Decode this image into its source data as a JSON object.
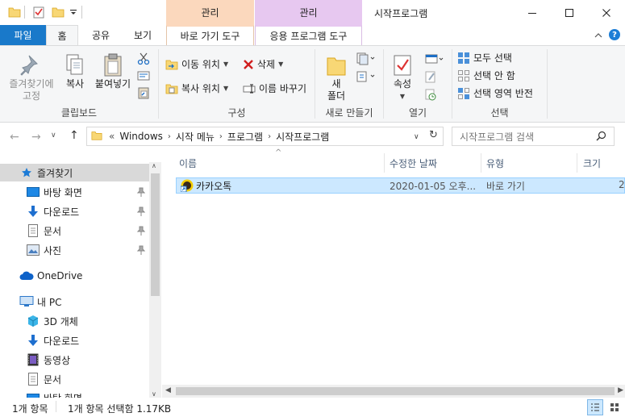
{
  "window": {
    "title": "시작프로그램",
    "context_tab_1": "관리",
    "context_tab_2": "관리",
    "context_sub_1": "바로 가기 도구",
    "context_sub_2": "응용 프로그램 도구"
  },
  "tabs": {
    "file": "파일",
    "home": "홈",
    "share": "공유",
    "view": "보기"
  },
  "ribbon": {
    "clipboard": {
      "label": "클립보드",
      "pin": "즐겨찾기에\n고정",
      "pin_line1": "즐겨찾기에",
      "pin_line2": "고정",
      "copy": "복사",
      "paste": "붙여넣기"
    },
    "organize": {
      "label": "구성",
      "move_to": "이동 위치",
      "copy_to": "복사 위치",
      "delete": "삭제",
      "rename": "이름 바꾸기"
    },
    "new": {
      "label": "새로 만들기",
      "new_folder_line1": "새",
      "new_folder_line2": "폴더"
    },
    "open": {
      "label": "열기",
      "properties": "속성"
    },
    "select": {
      "label": "선택",
      "select_all": "모두 선택",
      "select_none": "선택 안 함",
      "invert": "선택 영역 반전"
    }
  },
  "address": {
    "breadcrumbs": [
      "Windows",
      "시작 메뉴",
      "프로그램",
      "시작프로그램"
    ],
    "overflow": "«",
    "search_placeholder": "시작프로그램 검색"
  },
  "nav": {
    "quick_access": "즐겨찾기",
    "desktop": "바탕 화면",
    "downloads": "다운로드",
    "documents": "문서",
    "pictures": "사진",
    "onedrive": "OneDrive",
    "this_pc": "내 PC",
    "objects3d": "3D 개체",
    "pc_downloads": "다운로드",
    "videos": "동영상",
    "pc_documents": "문서",
    "pc_desktop": "바탕 화면"
  },
  "columns": {
    "name": "이름",
    "modified": "수정한 날짜",
    "type": "유형",
    "size": "크기"
  },
  "files": [
    {
      "name": "카카오톡",
      "modified": "2020-01-05 오후...",
      "type": "바로 가기",
      "size": "2"
    }
  ],
  "status": {
    "count": "1개 항목",
    "selected": "1개 항목 선택함 1.17KB"
  },
  "colors": {
    "file_tab": "#1979ca",
    "selection": "#cce8ff",
    "context_orange": "#fbd8bd",
    "context_purple": "#e7c8f0"
  }
}
